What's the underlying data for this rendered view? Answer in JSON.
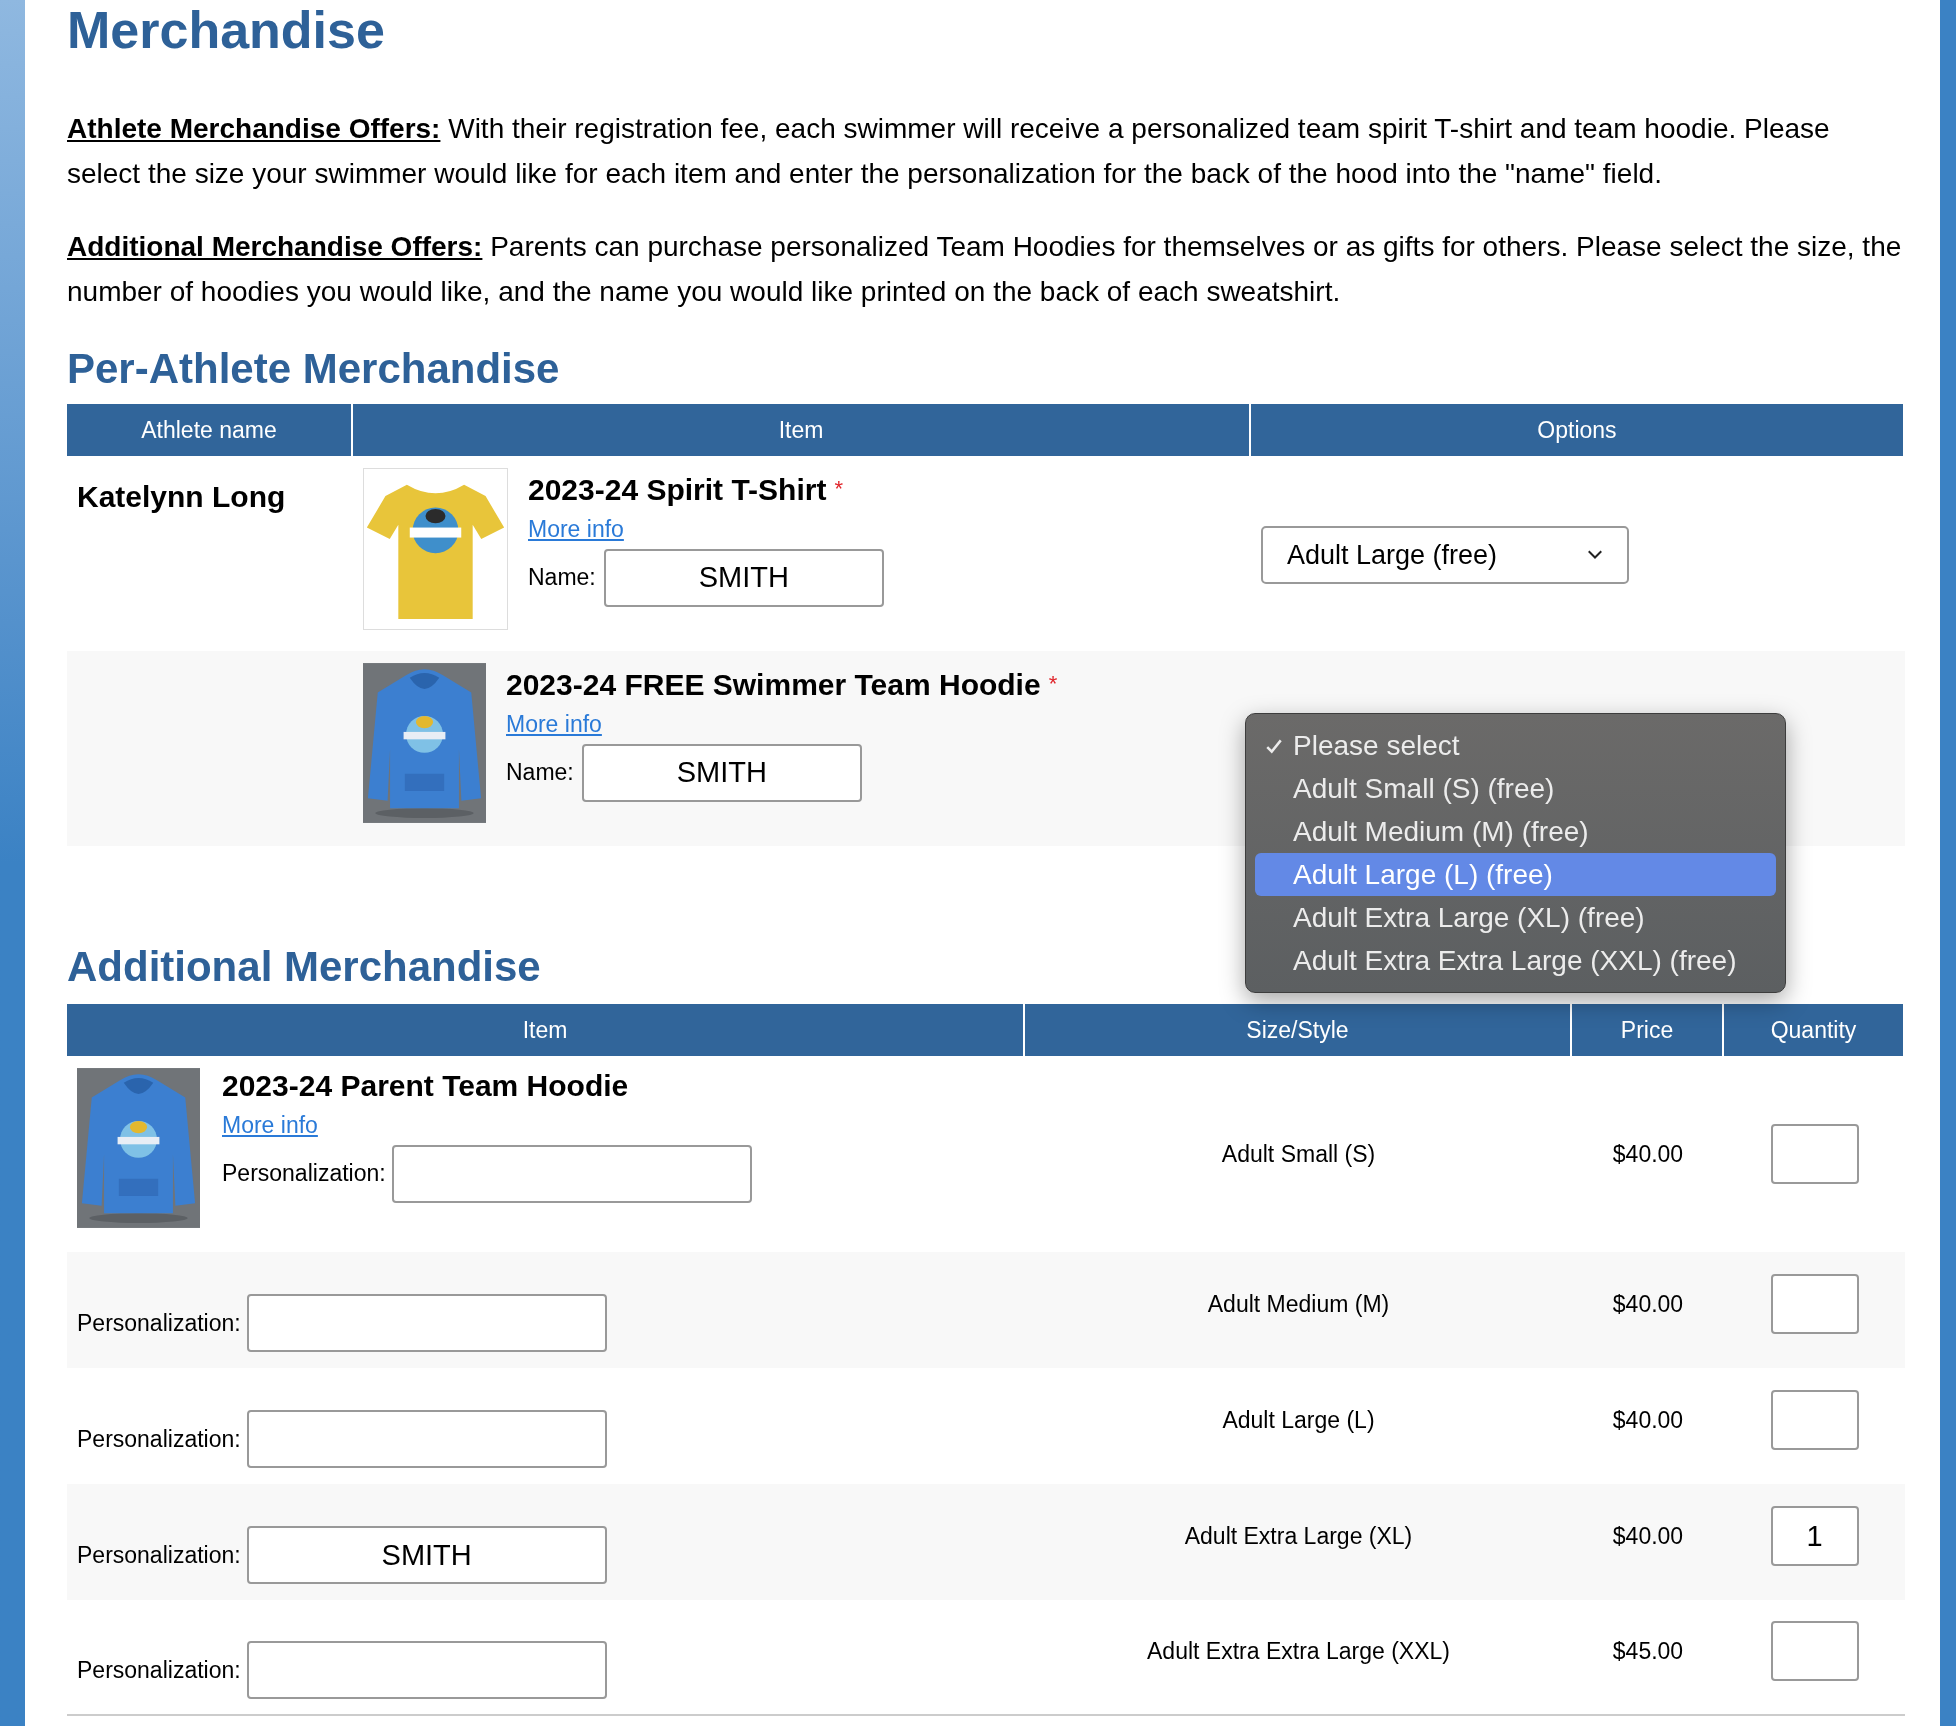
{
  "page_title": "Merchandise",
  "intro": [
    {
      "label": "Athlete Merchandise Offers:",
      "text": "With their registration fee, each swimmer will receive a personalized team spirit T-shirt and team hoodie. Please select the size your swimmer would like for each item and enter the personalization for the back of the hood into the \"name\" field."
    },
    {
      "label": "Additional Merchandise Offers:",
      "text": "Parents can purchase personalized Team Hoodies for themselves or as gifts for others.  Please select the size, the number of hoodies you would like, and the name you would like printed on the back of each sweatshirt."
    }
  ],
  "per_athlete": {
    "title": "Per-Athlete Merchandise",
    "columns": [
      "Athlete name",
      "Item",
      "Options"
    ],
    "athlete": "Katelynn Long",
    "items": [
      {
        "title": "2023-24 Spirit T-Shirt",
        "required_mark": "*",
        "link": "More info",
        "name_label": "Name:",
        "name_value": "SMITH",
        "option_value": "Adult Large (free)"
      },
      {
        "title": "2023-24 FREE Swimmer Team Hoodie",
        "required_mark": "*",
        "link": "More info",
        "name_label": "Name:",
        "name_value": "SMITH",
        "menu": [
          {
            "label": "Please select",
            "checked": true,
            "highlighted": false
          },
          {
            "label": "Adult Small (S) (free)",
            "checked": false,
            "highlighted": false
          },
          {
            "label": "Adult Medium (M) (free)",
            "checked": false,
            "highlighted": false
          },
          {
            "label": "Adult Large (L) (free)",
            "checked": false,
            "highlighted": true
          },
          {
            "label": "Adult Extra Large (XL) (free)",
            "checked": false,
            "highlighted": false
          },
          {
            "label": "Adult Extra Extra Large (XXL) (free)",
            "checked": false,
            "highlighted": false
          }
        ]
      }
    ]
  },
  "additional": {
    "title": "Additional Merchandise",
    "columns": [
      "Item",
      "Size/Style",
      "Price",
      "Quantity"
    ],
    "item": {
      "title": "2023-24 Parent Team Hoodie",
      "link": "More info"
    },
    "rows": [
      {
        "personalization_label": "Personalization:",
        "size": "Adult Small (S)",
        "price": "$40.00"
      },
      {
        "personalization_label": "Personalization:",
        "size": "Adult Medium (M)",
        "price": "$40.00"
      },
      {
        "personalization_label": "Personalization:",
        "size": "Adult Large (L)",
        "price": "$40.00"
      },
      {
        "personalization_label": "Personalization:",
        "personalization_value": "SMITH",
        "size": "Adult Extra Large (XL)",
        "price": "$40.00",
        "quantity": "1"
      },
      {
        "personalization_label": "Personalization:",
        "size": "Adult Extra Extra Large (XXL)",
        "price": "$45.00"
      }
    ]
  }
}
